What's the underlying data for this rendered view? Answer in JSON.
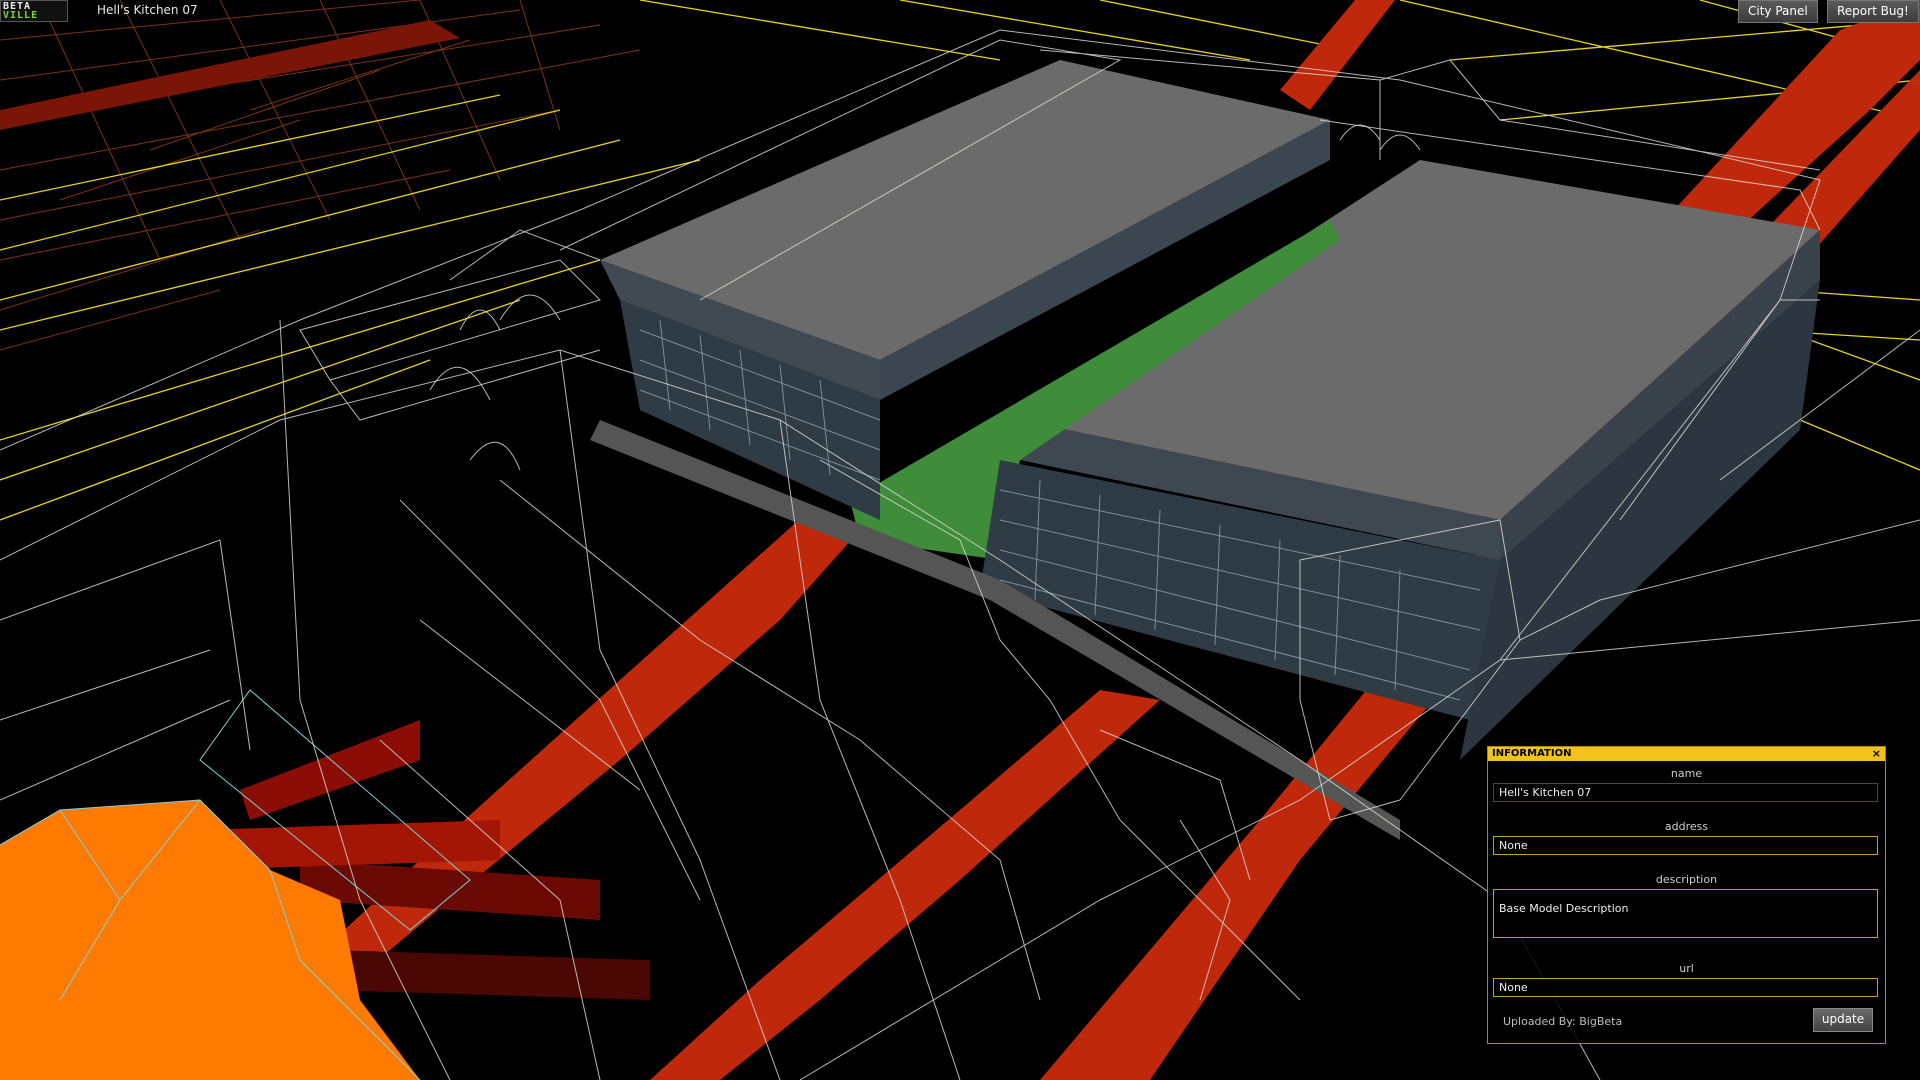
{
  "app": {
    "logo_line1": "BETA",
    "logo_line2": "VILLE",
    "window_title": "Hell's Kitchen 07"
  },
  "toolbar": {
    "city_panel_label": "City Panel",
    "report_bug_label": "Report Bug!"
  },
  "info_panel": {
    "header": "INFORMATION",
    "close_glyph": "×",
    "name_label": "name",
    "name_value": "Hell's Kitchen 07",
    "address_label": "address",
    "address_value": "None",
    "description_label": "description",
    "description_value": "Base Model Description",
    "url_label": "url",
    "url_value": "None",
    "uploaded_by": "Uploaded By: BigBeta",
    "update_label": "update"
  },
  "colors": {
    "background": "#000000",
    "accent_yellow": "#f2c21c",
    "road_red": "#c0280c",
    "roof_gray": "#6b6b6b",
    "courtyard_green": "#3f8c3a",
    "orange_block": "#ff7a00",
    "wire_white": "#d8d8d0"
  }
}
